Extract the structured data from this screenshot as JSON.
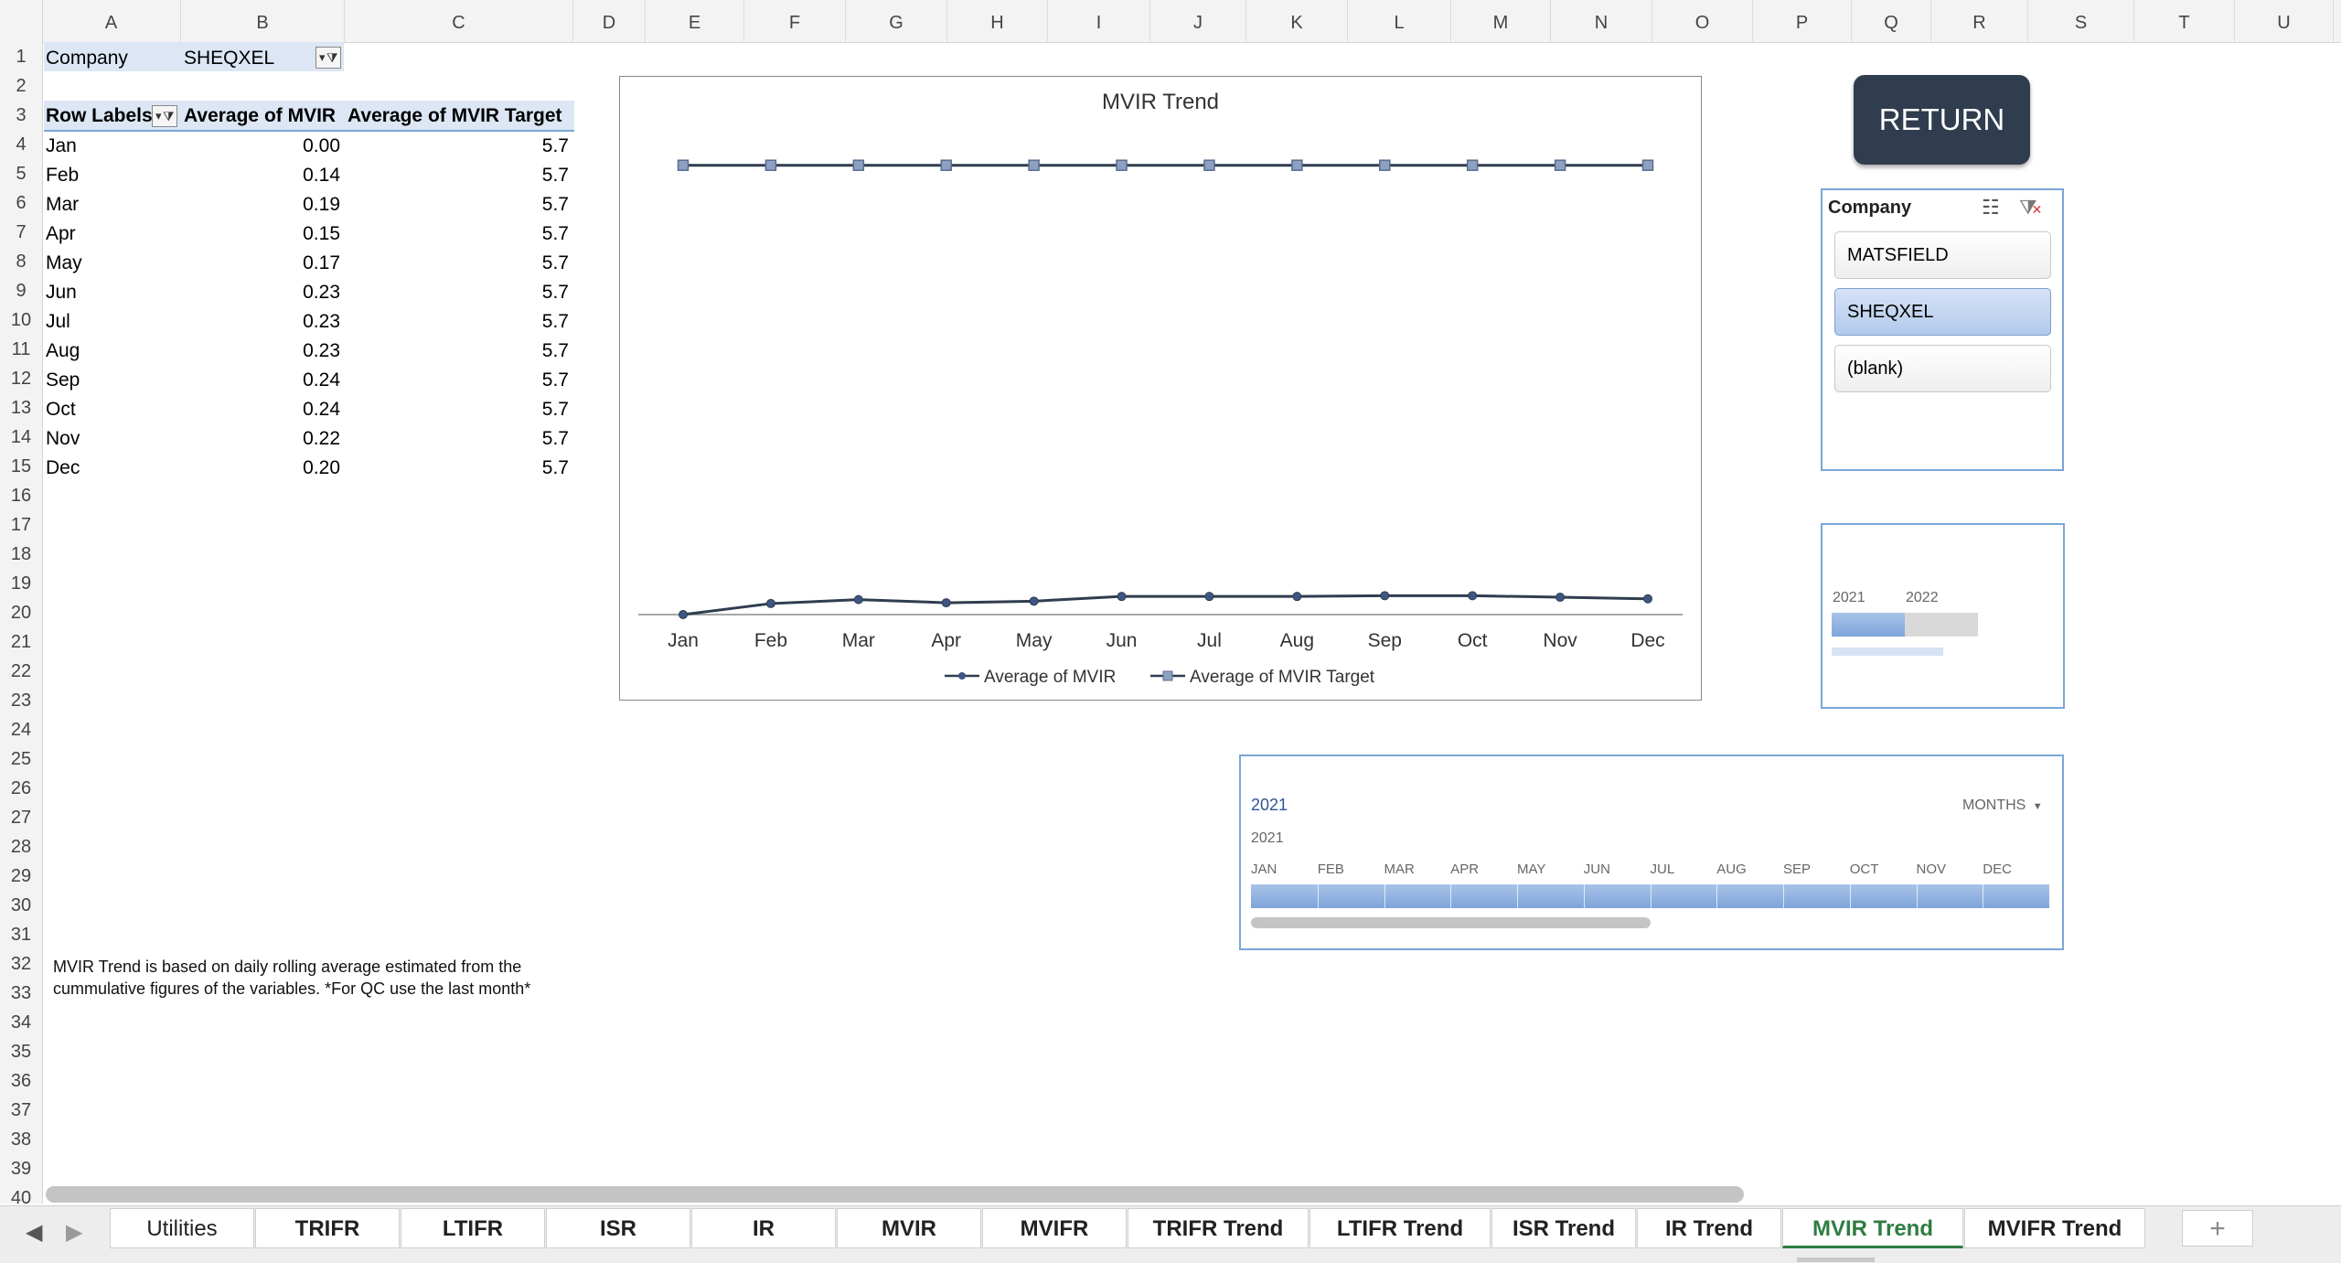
{
  "columns": [
    "A",
    "B",
    "C",
    "D",
    "E",
    "F",
    "G",
    "H",
    "I",
    "J",
    "K",
    "L",
    "M",
    "N",
    "O",
    "P",
    "Q",
    "R",
    "S",
    "T",
    "U"
  ],
  "rows": [
    "1",
    "2",
    "3",
    "4",
    "5",
    "6",
    "7",
    "8",
    "9",
    "10",
    "11",
    "12",
    "13",
    "14",
    "15",
    "16",
    "17",
    "18",
    "19",
    "20",
    "21",
    "22",
    "23",
    "24",
    "25",
    "26",
    "27",
    "28",
    "29",
    "30",
    "31",
    "32",
    "33",
    "34",
    "35",
    "36",
    "37",
    "38",
    "39",
    "40"
  ],
  "filter": {
    "label": "Company",
    "value": "SHEQXEL"
  },
  "pivot": {
    "headers": [
      "Row Labels",
      "Average of MVIR",
      "Average of MVIR Target"
    ],
    "rows": [
      {
        "month": "Jan",
        "mvir": "0.00",
        "target": "5.7"
      },
      {
        "month": "Feb",
        "mvir": "0.14",
        "target": "5.7"
      },
      {
        "month": "Mar",
        "mvir": "0.19",
        "target": "5.7"
      },
      {
        "month": "Apr",
        "mvir": "0.15",
        "target": "5.7"
      },
      {
        "month": "May",
        "mvir": "0.17",
        "target": "5.7"
      },
      {
        "month": "Jun",
        "mvir": "0.23",
        "target": "5.7"
      },
      {
        "month": "Jul",
        "mvir": "0.23",
        "target": "5.7"
      },
      {
        "month": "Aug",
        "mvir": "0.23",
        "target": "5.7"
      },
      {
        "month": "Sep",
        "mvir": "0.24",
        "target": "5.7"
      },
      {
        "month": "Oct",
        "mvir": "0.24",
        "target": "5.7"
      },
      {
        "month": "Nov",
        "mvir": "0.22",
        "target": "5.7"
      },
      {
        "month": "Dec",
        "mvir": "0.20",
        "target": "5.7"
      }
    ]
  },
  "chart_data": {
    "type": "line",
    "title": "MVIR Trend",
    "categories": [
      "Jan",
      "Feb",
      "Mar",
      "Apr",
      "May",
      "Jun",
      "Jul",
      "Aug",
      "Sep",
      "Oct",
      "Nov",
      "Dec"
    ],
    "series": [
      {
        "name": "Average of MVIR",
        "values": [
          0.0,
          0.14,
          0.19,
          0.15,
          0.17,
          0.23,
          0.23,
          0.23,
          0.24,
          0.24,
          0.22,
          0.2
        ],
        "color": "#2f3d4e",
        "marker": "circle"
      },
      {
        "name": "Average of MVIR Target",
        "values": [
          5.7,
          5.7,
          5.7,
          5.7,
          5.7,
          5.7,
          5.7,
          5.7,
          5.7,
          5.7,
          5.7,
          5.7
        ],
        "color": "#2f3d4e",
        "marker": "square",
        "marker_fill": "#8ea0c2"
      }
    ],
    "ylim": [
      0,
      6.3
    ],
    "grid": false,
    "legend": "bottom"
  },
  "return_label": "RETURN",
  "slicer": {
    "title": "Company",
    "items": [
      {
        "label": "MATSFIELD",
        "selected": false
      },
      {
        "label": "SHEQXEL",
        "selected": true
      },
      {
        "label": "(blank)",
        "selected": false
      }
    ]
  },
  "year_timeline": {
    "years": [
      "2021",
      "2022"
    ],
    "selected_fraction": 0.5
  },
  "month_timeline": {
    "title": "2021",
    "level_label": "MONTHS",
    "year": "2021",
    "months": [
      "JAN",
      "FEB",
      "MAR",
      "APR",
      "MAY",
      "JUN",
      "JUL",
      "AUG",
      "SEP",
      "OCT",
      "NOV",
      "DEC"
    ],
    "scroll_fraction": 0.5
  },
  "note": "MVIR Trend is based on daily rolling average estimated from the cummulative figures of the variables. *For QC use the last month*",
  "sheet_tabs": [
    "Utilities",
    "TRIFR",
    "LTIFR",
    "ISR",
    "IR",
    "MVIR",
    "MVIFR",
    "TRIFR Trend",
    "LTIFR Trend",
    "ISR Trend",
    "IR Trend",
    "MVIR Trend",
    "MVIFR Trend"
  ],
  "active_tab": "MVIR Trend",
  "colors": {
    "accent": "#2e7d43",
    "button": "#2f3d4e",
    "slicer_border": "#7aa6d6",
    "highlight": "#dce6f4"
  }
}
